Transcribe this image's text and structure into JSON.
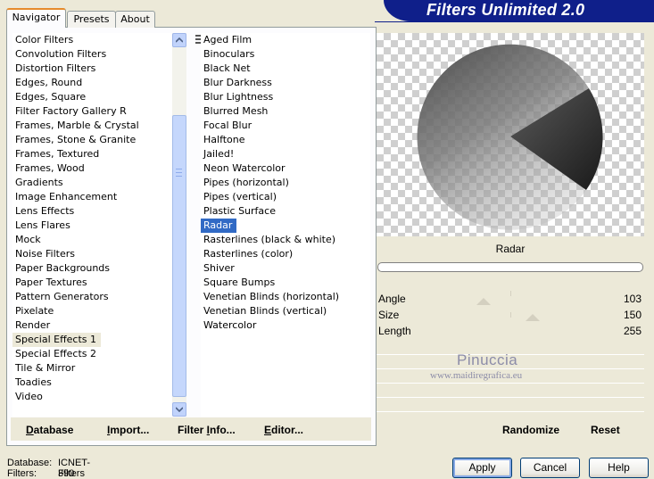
{
  "banner": {
    "title": "Filters Unlimited 2.0"
  },
  "tabs": [
    {
      "label": "Navigator",
      "active": true
    },
    {
      "label": "Presets",
      "active": false
    },
    {
      "label": "About",
      "active": false
    }
  ],
  "categories": {
    "items": [
      "Color Filters",
      "Convolution Filters",
      "Distortion Filters",
      "Edges, Round",
      "Edges, Square",
      "Filter Factory Gallery R",
      "Frames, Marble & Crystal",
      "Frames, Stone & Granite",
      "Frames, Textured",
      "Frames, Wood",
      "Gradients",
      "Image Enhancement",
      "Lens Effects",
      "Lens Flares",
      "Mock",
      "Noise Filters",
      "Paper Backgrounds",
      "Paper Textures",
      "Pattern Generators",
      "Pixelate",
      "Render",
      "Special Effects 1",
      "Special Effects 2",
      "Tile & Mirror",
      "Toadies",
      "Video"
    ],
    "selected": "Special Effects 1"
  },
  "filters": {
    "items": [
      "Aged Film",
      "Binoculars",
      "Black Net",
      "Blur Darkness",
      "Blur Lightness",
      "Blurred Mesh",
      "Focal Blur",
      "Halftone",
      "Jailed!",
      "Neon Watercolor",
      "Pipes (horizontal)",
      "Pipes (vertical)",
      "Plastic Surface",
      "Radar",
      "Rasterlines (black & white)",
      "Rasterlines (color)",
      "Shiver",
      "Square Bumps",
      "Venetian Blinds (horizontal)",
      "Venetian Blinds (vertical)",
      "Watercolor"
    ],
    "selected": "Radar"
  },
  "left_buttons": {
    "database": {
      "first": "D",
      "rest": "atabase"
    },
    "import": {
      "first": "I",
      "rest": "mport..."
    },
    "filter_info": {
      "first": "Filter ",
      "u": "I",
      "rest": "nfo..."
    },
    "editor": {
      "first": "E",
      "rest": "ditor..."
    }
  },
  "preview": {
    "filter_name": "Radar"
  },
  "params": [
    {
      "label": "Angle",
      "value": "103"
    },
    {
      "label": "Size",
      "value": "150"
    },
    {
      "label": "Length",
      "value": "255"
    }
  ],
  "watermark": {
    "line1": "Pinuccia",
    "line2": "www.maidiregrafica.eu"
  },
  "right_buttons": {
    "randomize": "Randomize",
    "reset": "Reset"
  },
  "status": {
    "database_label": "Database:",
    "database_value": "ICNET-Filters",
    "filters_label": "Filters:",
    "filters_value": "390"
  },
  "actions": {
    "apply": "Apply",
    "cancel": "Cancel",
    "help": "Help"
  },
  "colors": {
    "banner": "#0f1f8a",
    "selection": "#316ac5",
    "tab_accent": "#e68b2c"
  }
}
